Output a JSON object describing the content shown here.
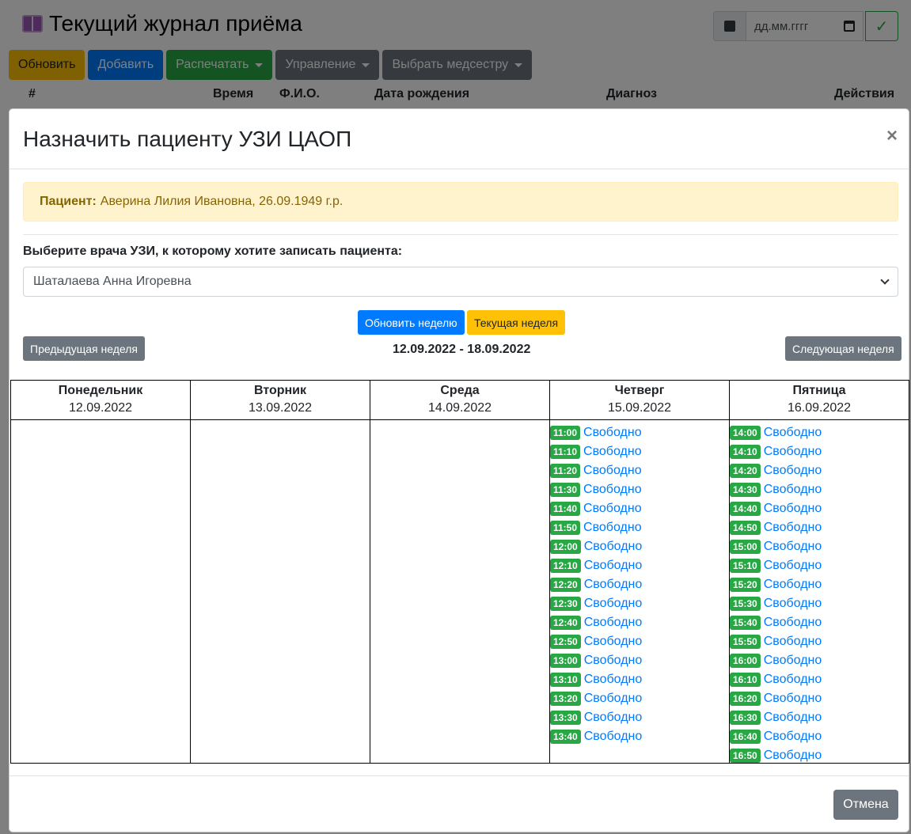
{
  "page": {
    "title": "Текущий журнал приёма",
    "date_placeholder": "дд.мм.гггг",
    "toolbar": {
      "refresh": "Обновить",
      "add": "Добавить",
      "print": "Распечатать",
      "manage": "Управление",
      "choose_nurse": "Выбрать медсестру"
    },
    "table_headers": {
      "num": "#",
      "time": "Время",
      "fio": "Ф.И.О.",
      "birthdate": "Дата рождения",
      "diagnosis": "Диагноз",
      "actions": "Действия"
    }
  },
  "modal": {
    "title": "Назначить пациенту УЗИ ЦАОП",
    "close": "×",
    "patient_label": "Пациент:",
    "patient_value": "Аверина Лилия Ивановна, 26.09.1949 г.р.",
    "select_label": "Выберите врача УЗИ, к которому хотите записать пациента:",
    "selected_doctor": "Шаталаева Анна Игоревна",
    "refresh_week": "Обновить неделю",
    "current_week": "Текущая неделя",
    "prev_week": "Предыдущая неделя",
    "next_week": "Следующая неделя",
    "week_range": "12.09.2022 - 18.09.2022",
    "cancel": "Отмена",
    "days": [
      {
        "name": "Понедельник",
        "date": "12.09.2022",
        "slots": []
      },
      {
        "name": "Вторник",
        "date": "13.09.2022",
        "slots": []
      },
      {
        "name": "Среда",
        "date": "14.09.2022",
        "slots": []
      },
      {
        "name": "Четверг",
        "date": "15.09.2022",
        "slots": [
          {
            "time": "11:00",
            "status": "Свободно"
          },
          {
            "time": "11:10",
            "status": "Свободно"
          },
          {
            "time": "11:20",
            "status": "Свободно"
          },
          {
            "time": "11:30",
            "status": "Свободно"
          },
          {
            "time": "11:40",
            "status": "Свободно"
          },
          {
            "time": "11:50",
            "status": "Свободно"
          },
          {
            "time": "12:00",
            "status": "Свободно"
          },
          {
            "time": "12:10",
            "status": "Свободно"
          },
          {
            "time": "12:20",
            "status": "Свободно"
          },
          {
            "time": "12:30",
            "status": "Свободно"
          },
          {
            "time": "12:40",
            "status": "Свободно"
          },
          {
            "time": "12:50",
            "status": "Свободно"
          },
          {
            "time": "13:00",
            "status": "Свободно"
          },
          {
            "time": "13:10",
            "status": "Свободно"
          },
          {
            "time": "13:20",
            "status": "Свободно"
          },
          {
            "time": "13:30",
            "status": "Свободно"
          },
          {
            "time": "13:40",
            "status": "Свободно"
          }
        ]
      },
      {
        "name": "Пятница",
        "date": "16.09.2022",
        "slots": [
          {
            "time": "14:00",
            "status": "Свободно"
          },
          {
            "time": "14:10",
            "status": "Свободно"
          },
          {
            "time": "14:20",
            "status": "Свободно"
          },
          {
            "time": "14:30",
            "status": "Свободно"
          },
          {
            "time": "14:40",
            "status": "Свободно"
          },
          {
            "time": "14:50",
            "status": "Свободно"
          },
          {
            "time": "15:00",
            "status": "Свободно"
          },
          {
            "time": "15:10",
            "status": "Свободно"
          },
          {
            "time": "15:20",
            "status": "Свободно"
          },
          {
            "time": "15:30",
            "status": "Свободно"
          },
          {
            "time": "15:40",
            "status": "Свободно"
          },
          {
            "time": "15:50",
            "status": "Свободно"
          },
          {
            "time": "16:00",
            "status": "Свободно"
          },
          {
            "time": "16:10",
            "status": "Свободно"
          },
          {
            "time": "16:20",
            "status": "Свободно"
          },
          {
            "time": "16:30",
            "status": "Свободно"
          },
          {
            "time": "16:40",
            "status": "Свободно"
          },
          {
            "time": "16:50",
            "status": "Свободно"
          }
        ]
      }
    ]
  },
  "colors": {
    "primary": "#007bff",
    "warning": "#ffc107",
    "success": "#28a745",
    "secondary": "#6c757d",
    "alert_bg": "#fff3cd",
    "alert_text": "#856404"
  }
}
